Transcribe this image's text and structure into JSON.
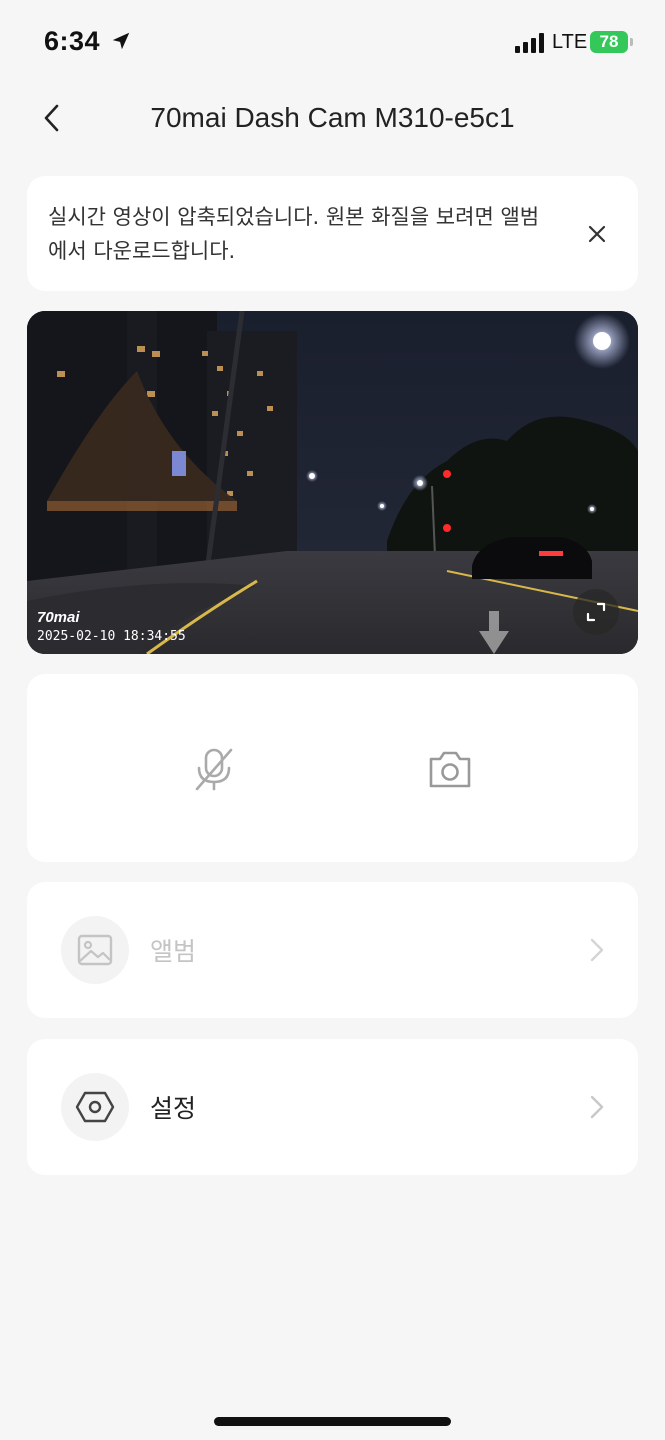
{
  "status_bar": {
    "time": "6:34",
    "network": "LTE",
    "battery": "78"
  },
  "header": {
    "title": "70mai Dash Cam M310-e5c1"
  },
  "notice": {
    "text": "실시간 영상이 압축되었습니다. 원본 화질을 보려면 앨범에서 다운로드합니다."
  },
  "video": {
    "brand": "70mai",
    "timestamp": "2025-02-10  18:34:55"
  },
  "controls": {
    "mute_icon": "mic-off-icon",
    "snapshot_icon": "camera-icon"
  },
  "menu": {
    "album_label": "앨범",
    "settings_label": "설정"
  },
  "colors": {
    "background": "#f6f6f6",
    "card": "#ffffff",
    "battery_green": "#34c759",
    "disabled_text": "#c4c4c4"
  }
}
